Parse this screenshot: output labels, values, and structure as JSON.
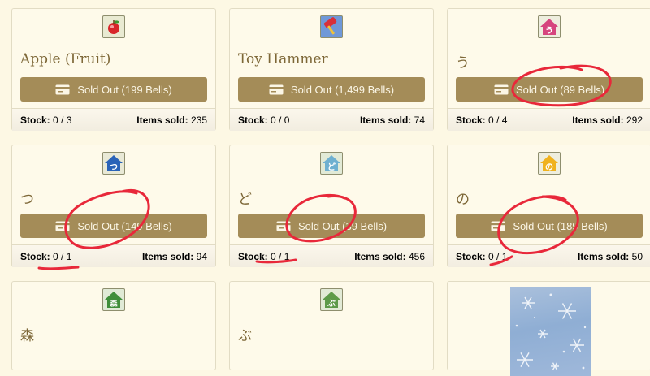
{
  "cards": [
    {
      "name": "Apple (Fruit)",
      "button": "Sold Out (199 Bells)",
      "stock_label": "Stock:",
      "stock": "0 / 3",
      "sold_label": "Items sold:",
      "sold": "235",
      "icon": "apple-icon",
      "tile_color": "#e9ead2"
    },
    {
      "name": "Toy Hammer",
      "button": "Sold Out (1,499 Bells)",
      "stock_label": "Stock:",
      "stock": "0 / 0",
      "sold_label": "Items sold:",
      "sold": "74",
      "icon": "toy-hammer-icon",
      "tile_color": "#6f98d8"
    },
    {
      "name": "う",
      "button": "Sold Out (89 Bells)",
      "stock_label": "Stock:",
      "stock": "0 / 4",
      "sold_label": "Items sold:",
      "sold": "292",
      "icon": "house-u-icon",
      "tile_color": "#eeeede"
    },
    {
      "name": "つ",
      "button": "Sold Out (149 Bells)",
      "stock_label": "Stock:",
      "stock": "0 / 1",
      "sold_label": "Items sold:",
      "sold": "94",
      "icon": "house-tsu-icon",
      "tile_color": "#e9e9d6"
    },
    {
      "name": "ど",
      "button": "Sold Out (39 Bells)",
      "stock_label": "Stock:",
      "stock": "0 / 1",
      "sold_label": "Items sold:",
      "sold": "456",
      "icon": "house-do-icon",
      "tile_color": "#e2ead6"
    },
    {
      "name": "の",
      "button": "Sold Out (189 Bells)",
      "stock_label": "Stock:",
      "stock": "0 / 1",
      "sold_label": "Items sold:",
      "sold": "50",
      "icon": "house-no-icon",
      "tile_color": "#eeeede"
    },
    {
      "name": "森",
      "icon": "house-mori-icon",
      "tile_color": "#e0ead6"
    },
    {
      "name": "ぶ",
      "icon": "house-bu-icon",
      "tile_color": "#e2ead6"
    }
  ],
  "colors": {
    "background": "#fdf8e4",
    "card": "#fefaea",
    "button": "#a48c58",
    "button_text": "#fbf6e6",
    "item_name": "#7d6737",
    "annotation": "#e8283a"
  }
}
